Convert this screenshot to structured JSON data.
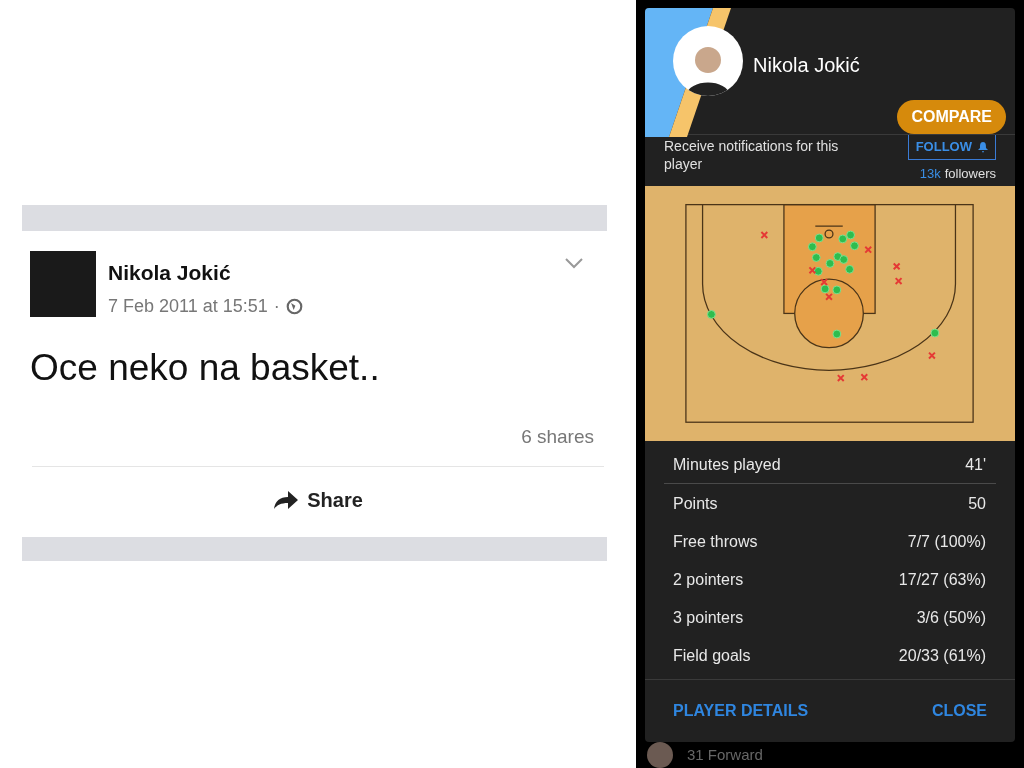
{
  "facebook_post": {
    "author": "Nikola Jokić",
    "timestamp": "7 Feb 2011 at 15:51",
    "separator": "·",
    "text": "Oce neko na basket..",
    "shares": "6 shares",
    "share_button": "Share"
  },
  "player_card": {
    "name": "Nikola Jokić",
    "compare_button": "COMPARE",
    "notification_text": "Receive notifications for this player",
    "follow_button": "FOLLOW",
    "followers_count": "13k",
    "followers_label": "followers",
    "shots": [
      {
        "made": true
      },
      {
        "made": true
      },
      {
        "made": true
      },
      {
        "made": true
      },
      {
        "made": true
      },
      {
        "made": true
      },
      {
        "made": true
      },
      {
        "made": true
      },
      {
        "made": true
      },
      {
        "made": true
      },
      {
        "made": true
      },
      {
        "made": true
      },
      {
        "made": true
      },
      {
        "made": true
      },
      {
        "made": true
      },
      {
        "made": true
      },
      {
        "made": false
      },
      {
        "made": false
      },
      {
        "made": false
      },
      {
        "made": false
      },
      {
        "made": false
      },
      {
        "made": false
      },
      {
        "made": false
      },
      {
        "made": false
      },
      {
        "made": false
      },
      {
        "made": false
      }
    ],
    "stats": [
      {
        "label": "Minutes played",
        "value": "41'"
      },
      {
        "label": "Points",
        "value": "50"
      },
      {
        "label": "Free throws",
        "value": "7/7 (100%)"
      },
      {
        "label": "2 pointers",
        "value": "17/27 (63%)"
      },
      {
        "label": "3 pointers",
        "value": "3/6 (50%)"
      },
      {
        "label": "Field goals",
        "value": "20/33 (61%)"
      }
    ],
    "footer_buttons": [
      "PLAYER DETAILS",
      "CLOSE"
    ]
  },
  "background_row": {
    "text": "31 Forward"
  }
}
